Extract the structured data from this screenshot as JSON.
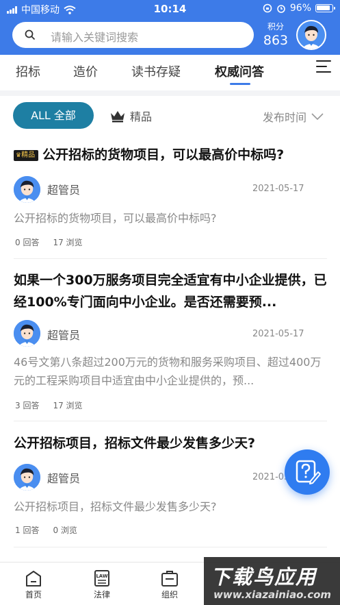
{
  "status_bar": {
    "carrier": "中国移动",
    "time": "10:14",
    "battery": "96%"
  },
  "search": {
    "placeholder": "请输入关键词搜索"
  },
  "points": {
    "label": "积分",
    "value": "863"
  },
  "tabs": [
    {
      "label": "招标",
      "active": false
    },
    {
      "label": "造价",
      "active": false
    },
    {
      "label": "读书存疑",
      "active": false
    },
    {
      "label": "权威问答",
      "active": true
    }
  ],
  "filters": {
    "all_label": "ALL 全部",
    "best_label": "精品",
    "sort_label": "发布时间"
  },
  "questions": [
    {
      "badge": "精品",
      "title": "公开招标的货物项目，可以最高价中标吗?",
      "author": "超管员",
      "date": "2021-05-17",
      "body": "公开招标的货物项目，可以最高价中标吗?",
      "answers": "0 回答",
      "views": "17 浏览"
    },
    {
      "badge": "",
      "title": "如果一个300万服务项目完全适宜有中小企业提供，已经100%专门面向中小企业。是否还需要预...",
      "author": "超管员",
      "date": "2021-05-17",
      "body": "46号文第八条超过200万元的货物和服务采购项目、超过400万元的工程采购项目中适宜由中小企业提供的，预...",
      "answers": "3 回答",
      "views": "17 浏览"
    },
    {
      "badge": "",
      "title": "公开招标项目，招标文件最少发售多少天?",
      "author": "超管员",
      "date": "2021-05",
      "body": "公开招标项目，招标文件最少发售多少天?",
      "answers": "1 回答",
      "views": "0 浏览"
    }
  ],
  "bottom_nav": [
    {
      "label": "首页",
      "icon": "home-icon"
    },
    {
      "label": "法律",
      "icon": "law-book-icon",
      "icon_text": "LAW"
    },
    {
      "label": "组织",
      "icon": "organization-icon"
    }
  ],
  "watermark": {
    "title": "下载鸟应用",
    "url": "www.xiazainiao.com"
  },
  "colors": {
    "primary": "#3d7be8",
    "filter_active": "#1e7fa3",
    "fab": "#2f7cf0"
  }
}
